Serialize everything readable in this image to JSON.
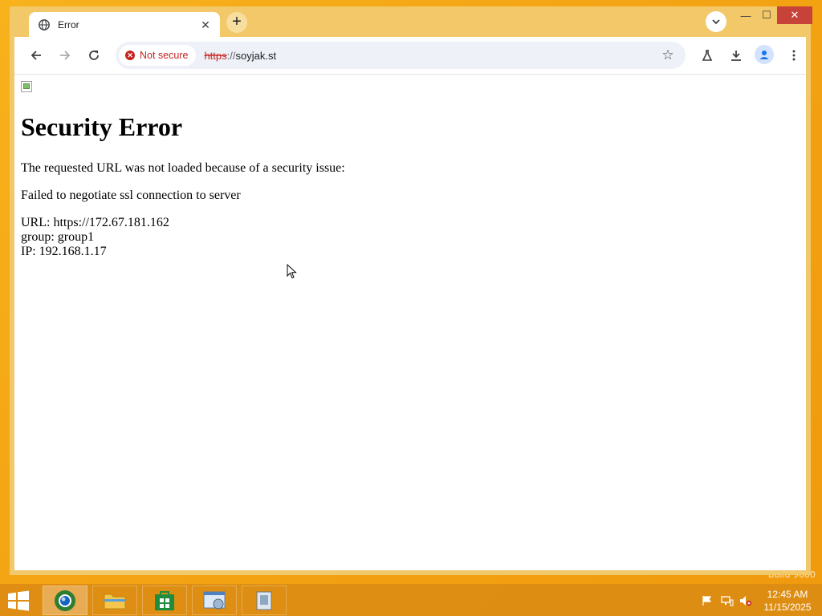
{
  "desktop": {
    "watermark": "Build 9600"
  },
  "browser": {
    "tab": {
      "title": "Error",
      "icon": "globe-icon",
      "close_label": "✕"
    },
    "new_tab_label": "+",
    "window_controls": {
      "minimize": "—",
      "maximize": "☐",
      "close": "✕"
    },
    "toolbar": {
      "security_label": "Not secure",
      "url_scheme": "https",
      "url_separator": "://",
      "url_host": "soyjak.st"
    }
  },
  "page": {
    "heading": "Security Error",
    "message": "The requested URL was not loaded because of a security issue:",
    "reason": "Failed to negotiate ssl connection to server",
    "details": {
      "url": "URL: https://172.67.181.162",
      "group": "group: group1",
      "ip": "IP: 192.168.1.17"
    }
  },
  "taskbar": {
    "apps": [
      "browser-icon",
      "file-explorer-icon",
      "store-icon",
      "control-panel-icon",
      "installer-icon"
    ],
    "clock": {
      "time": "12:45 AM",
      "date": "11/15/2025"
    }
  }
}
